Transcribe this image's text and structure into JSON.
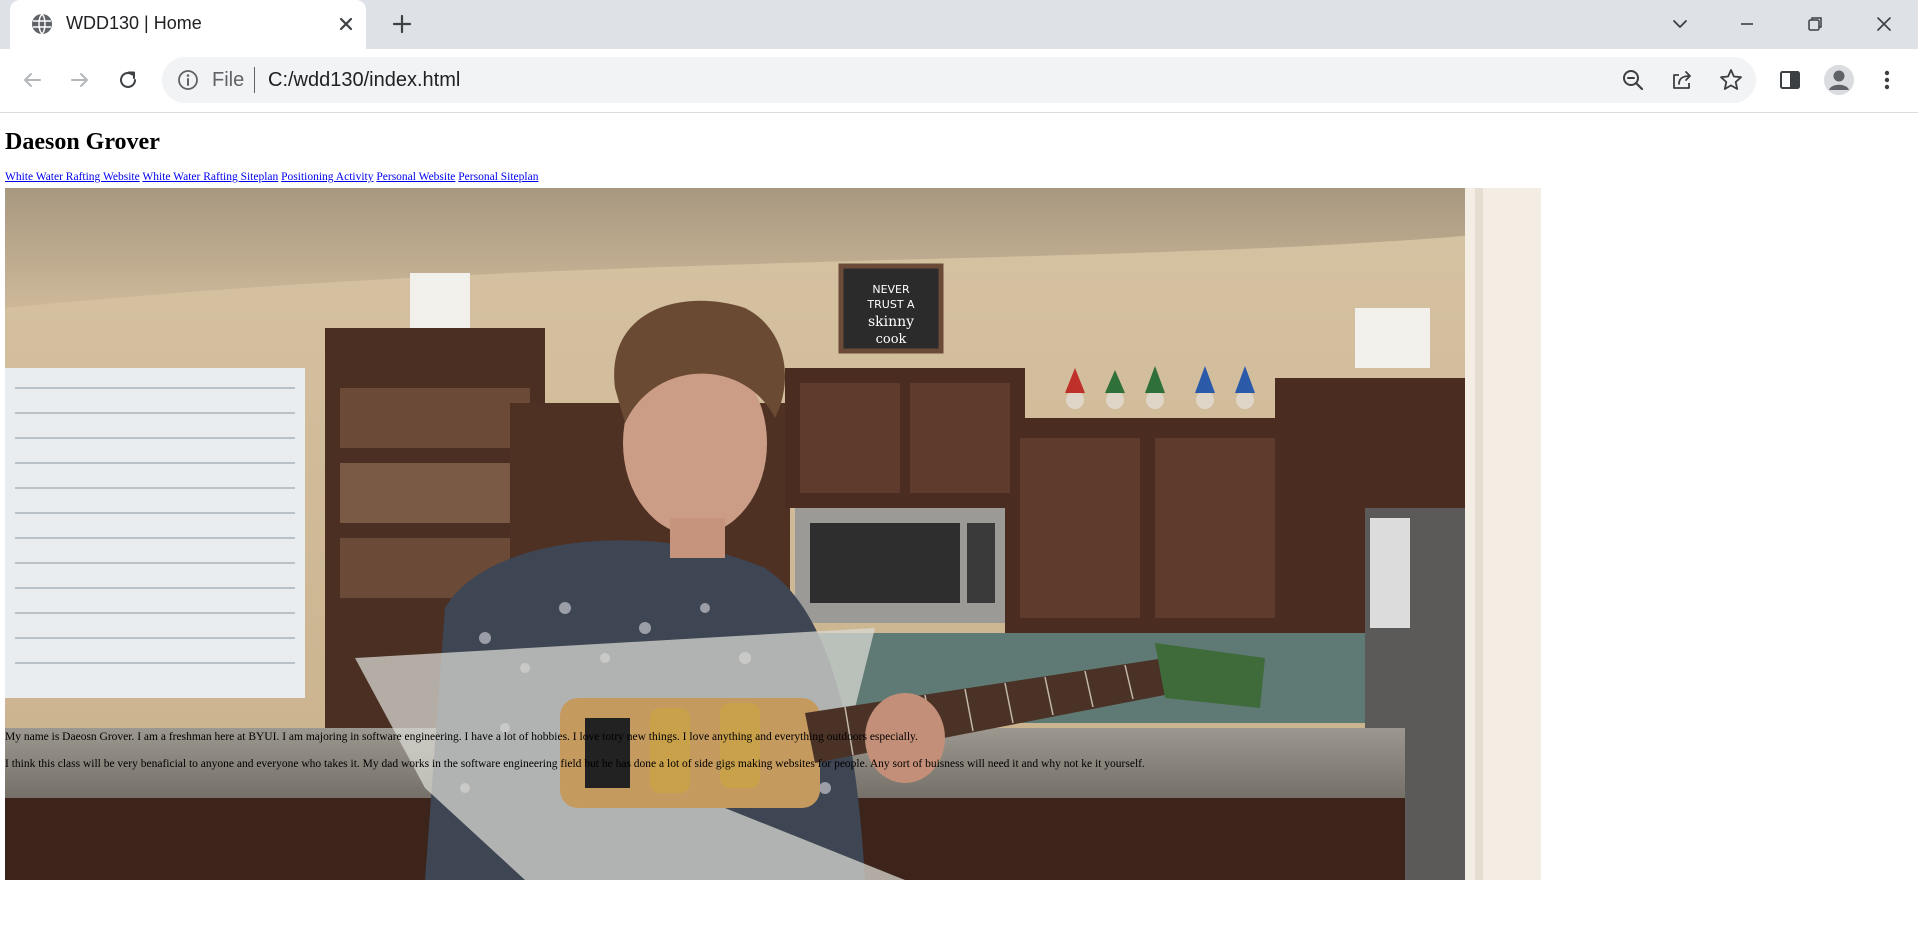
{
  "browser": {
    "tab": {
      "title": "WDD130 | Home",
      "favicon": "globe-icon"
    },
    "address_bar": {
      "scheme_label": "File",
      "url": "C:/wdd130/index.html"
    },
    "icons": {
      "back": "arrow-left-icon",
      "forward": "arrow-right-icon",
      "reload": "reload-icon",
      "zoom": "zoom-out-icon",
      "share": "share-icon",
      "bookmark": "star-icon",
      "side_panel": "side-panel-icon",
      "profile": "person-icon",
      "menu": "kebab-menu-icon"
    }
  },
  "page": {
    "heading": "Daeson Grover",
    "nav_links": [
      "White Water Rafting Website",
      "White Water Rafting Siteplan",
      "Positioning Activity",
      "Personal Website",
      "Personal Siteplan"
    ],
    "paragraphs": [
      "My name is Daeosn Grover. I am a freshman here at BYUI. I am majoring in software engineering. I have a lot of hobbies. I love totry new things. I love anything and everything outdoors especially.",
      "I think this class will be very benaficial to anyone and everyone who takes it. My dad works in the software engineering field but he has done a lot of side gigs making websites for people. Any sort of buisness will need it and why not ke it yourself."
    ],
    "sign_text": "NEVER TRUST A skinny cook"
  },
  "colors": {
    "tabstrip_bg": "#dee1e6",
    "omnibox_bg": "#f1f3f4",
    "link": "#0000ee"
  }
}
